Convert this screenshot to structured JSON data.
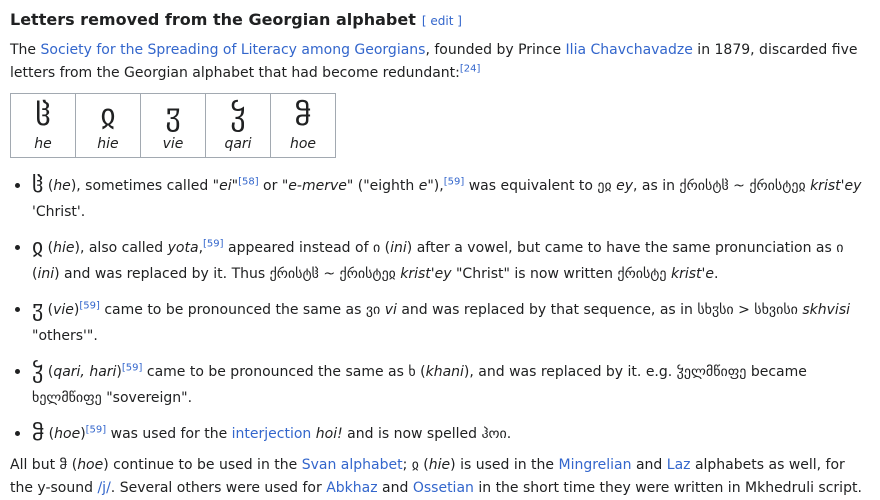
{
  "heading": {
    "title": "Letters removed from the Georgian alphabet",
    "edit": "[ edit ]"
  },
  "intro": {
    "t1": "The ",
    "link1": "Society for the Spreading of Literacy among Georgians",
    "t2": ", founded by Prince ",
    "link2": "Ilia Chavchavadze",
    "t3": " in 1879, discarded five letters from the Georgian alphabet that had become redundant:",
    "ref": "[24]"
  },
  "letters": [
    {
      "glyph": "ჱ",
      "name": "he"
    },
    {
      "glyph": "ჲ",
      "name": "hie"
    },
    {
      "glyph": "ჳ",
      "name": "vie"
    },
    {
      "glyph": "ჴ",
      "name": "qari"
    },
    {
      "glyph": "ჵ",
      "name": "hoe"
    }
  ],
  "bullets": {
    "b1": {
      "glyph": "ჱ",
      "a": " (",
      "name": "he",
      "b": "), sometimes called \"",
      "ei": "ei",
      "c": "\"",
      "ref1": "[58]",
      "d": " or \"",
      "emerve": "e-merve",
      "e": "\" (\"eighth ",
      "eital": "e",
      "f": "\"),",
      "ref2": "[59]",
      "g": " was equivalent to ეჲ ",
      "ey": "ey",
      "h": ", as in ქრისტჱ ~ ქრისტეჲ ",
      "kristey": "krist'ey",
      "i": " 'Christ'."
    },
    "b2": {
      "glyph": "ჲ",
      "a": " (",
      "name": "hie",
      "b": "), also called ",
      "yota": "yota",
      "c": ",",
      "ref": "[59]",
      "d": " appeared instead of ი (",
      "ini": "ini",
      "e": ") after a vowel, but came to have the same pronunciation as ი (",
      "ini2": "ini",
      "f": ") and was replaced by it. Thus ქრისტჱ ~ ქრისტეჲ ",
      "kristey": "krist'ey",
      "g": " \"Christ\" is now written ქრისტე ",
      "kriste": "krist'e",
      "h": "."
    },
    "b3": {
      "glyph": "ჳ",
      "a": " (",
      "name": "vie",
      "b": ")",
      "ref": "[59]",
      "c": " came to be pronounced the same as ვი ",
      "vi": "vi",
      "d": " and was replaced by that sequence, as in სხჳსი > სხვისი ",
      "skhvisi": "skhvisi",
      "e": " \"others'\"."
    },
    "b4": {
      "glyph": "ჴ",
      "a": " (",
      "name": "qari, hari",
      "b": ")",
      "ref": "[59]",
      "c": " came to be pronounced the same as ხ (",
      "khani": "khani",
      "d": "), and was replaced by it. e.g. ჴელმწიფე became ხელმწიფე \"sovereign\"."
    },
    "b5": {
      "glyph": "ჵ",
      "a": " (",
      "name": "hoe",
      "b": ")",
      "ref": "[59]",
      "c": " was used for the ",
      "link": "interjection",
      "d": " ",
      "hoi": "hoi!",
      "e": " and is now spelled ჰოი."
    }
  },
  "closing": {
    "a": "All but ჵ (",
    "hoe": "hoe",
    "b": ") continue to be used in the ",
    "svan": "Svan alphabet",
    "c": "; ჲ (",
    "hie": "hie",
    "d": ") is used in the ",
    "mingrelian": "Mingrelian",
    "e": " and ",
    "laz": "Laz",
    "f": " alphabets as well, for the y-sound ",
    "j": "/j/",
    "g": ". Several others were used for ",
    "abkhaz": "Abkhaz",
    "h": " and ",
    "ossetian": "Ossetian",
    "i": " in the short time they were written in Mkhedruli script."
  },
  "colors": {
    "link": "#3366cc",
    "text": "#202122",
    "border": "#a2a9b1"
  }
}
